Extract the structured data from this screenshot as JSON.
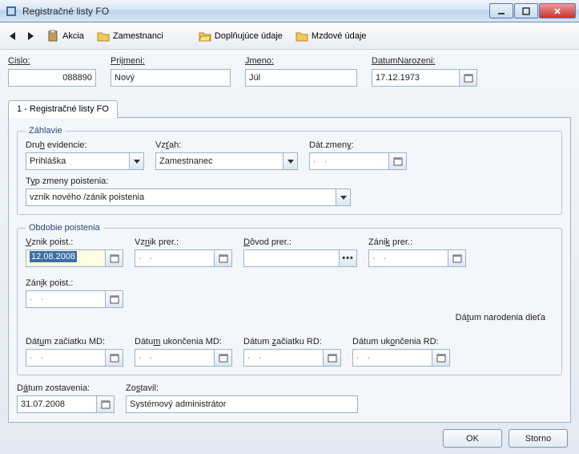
{
  "window": {
    "title": "Registračné listy FO"
  },
  "toolbar": {
    "akcia": "Akcia",
    "zamestnanci": "Zamestnanci",
    "doplnujuce": "Doplňujúce údaje",
    "mzdove": "Mzdové údaje"
  },
  "top": {
    "cislo_lbl": "Cislo:",
    "cislo": "088890",
    "prijmeni_lbl": "Prijmeni:",
    "prijmeni": "Nový",
    "jmeno_lbl": "Jmeno:",
    "jmeno": "Júl",
    "datnar_lbl": "DatumNarozeni:",
    "datnar": "17.12.1973"
  },
  "tab": {
    "label": "1 - Registračné listy FO"
  },
  "zahlavie": {
    "legend": "Záhlavie",
    "druh_lbl": "Druh evidencie:",
    "druh": "Prihláška",
    "vztah_lbl": "Vzťah:",
    "vztah": "Zamestnanec",
    "datz_lbl": "Dát.zmeny:",
    "datz": ".  .",
    "typ_lbl": "Typ zmeny poistenia:",
    "typ": "vznik nového /zánik poistenia"
  },
  "obdobie": {
    "legend": "Obdobie poistenia",
    "vznikpoist_lbl": "Vznik poist.:",
    "vznikpoist": "12.08.2008",
    "vznikprer_lbl": "Vznik prer.:",
    "vznikprer": ".  .",
    "dovodprer_lbl": "Dôvod prer.:",
    "dovodprer": "",
    "zanikprer_lbl": "Zánik prer.:",
    "zanikprer": ".  .",
    "zanikpoist_lbl": "Zánik poist.:",
    "zanikpoist": ".  .",
    "datnardieta_lbl": "Dátum narodenia dieťa",
    "zacmd_lbl": "Dátum začiatku MD:",
    "zacmd": ".  .",
    "ukonmd_lbl": "Dátum ukončenia MD:",
    "ukonmd": ".  .",
    "zacrd_lbl": "Dátum začiatku RD:",
    "zacrd": ".  .",
    "ukonrd_lbl": "Dátum ukončenia RD:",
    "ukonrd": ".  ."
  },
  "footer": {
    "datzost_lbl": "Dátum zostavenia:",
    "datzost": "31.07.2008",
    "zostavil_lbl": "Zostavil:",
    "zostavil": "Systémový administrátor"
  },
  "buttons": {
    "ok": "OK",
    "storno": "Storno"
  }
}
